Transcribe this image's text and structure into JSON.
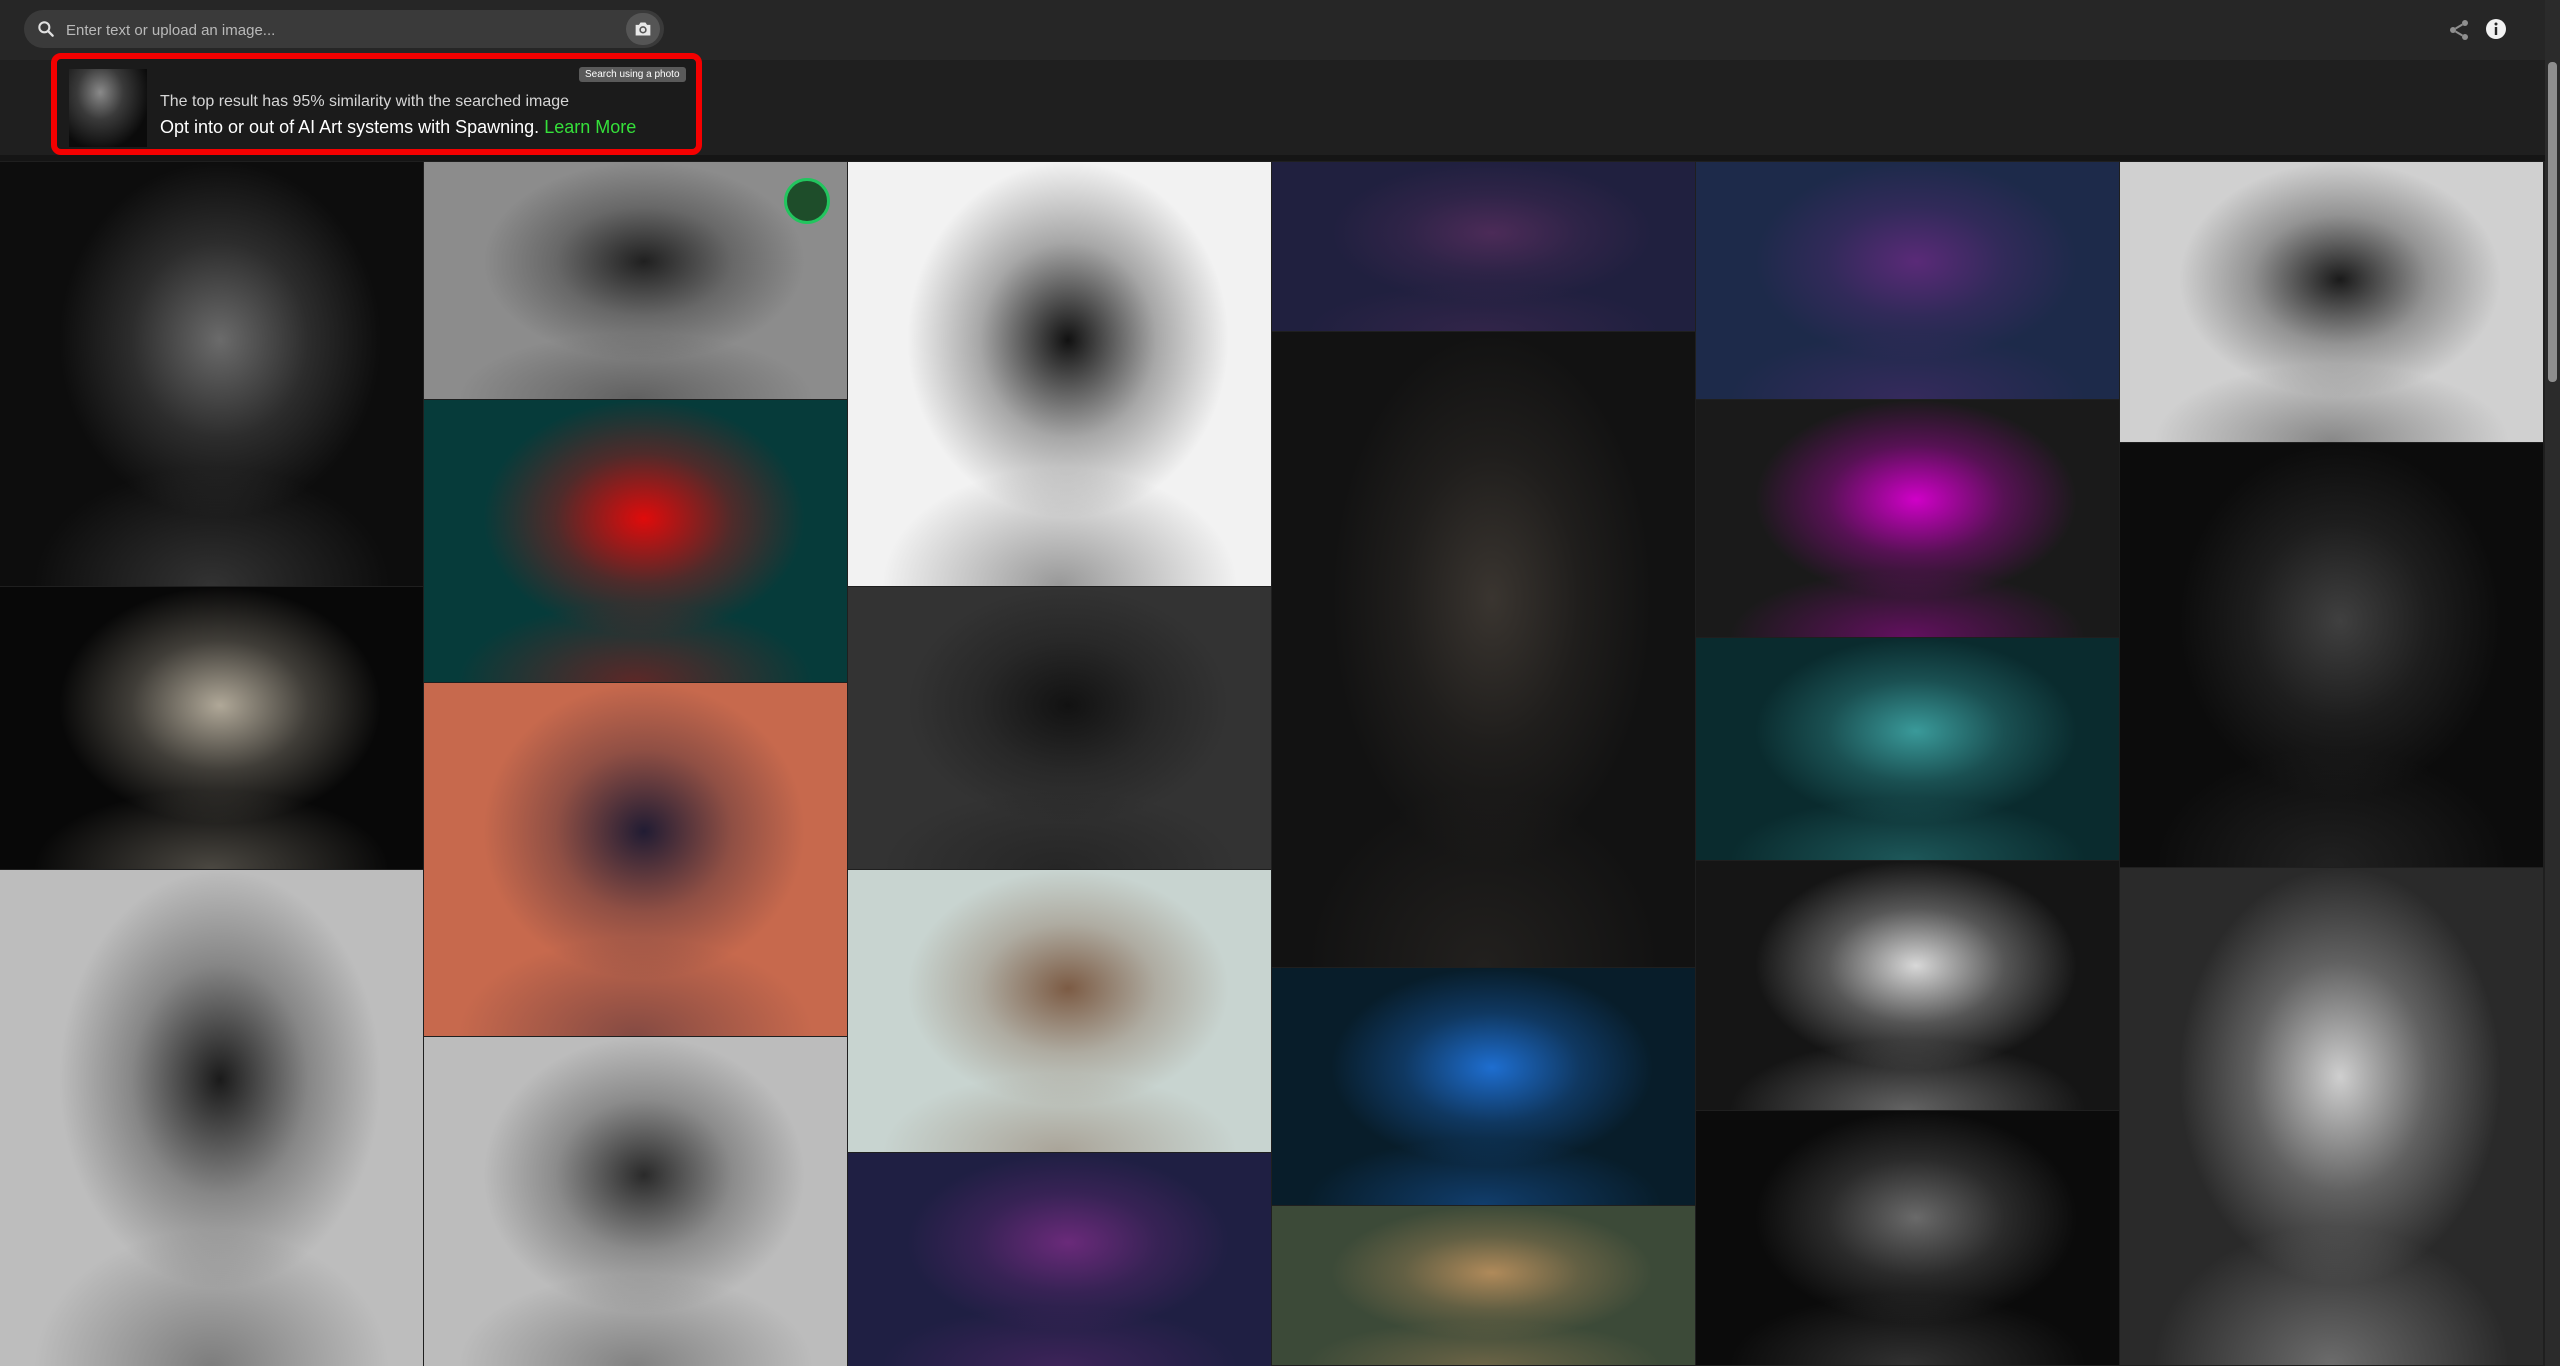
{
  "search": {
    "placeholder": "Enter text or upload an image..."
  },
  "toolbar": {
    "camera_tooltip": "Search using a photo",
    "icons": [
      "search-icon",
      "camera-icon",
      "share-icon",
      "info-icon"
    ]
  },
  "banner": {
    "similarity_text": "The top result has 95% similarity with the searched image",
    "optin_text": "Opt into or out of AI Art systems with Spawning.",
    "learn_more": "Learn More",
    "accent_color": "#35e03a",
    "border_color": "#f40000"
  },
  "results": {
    "columns": [
      [
        {
          "bg": "#0d0d0d",
          "accent": "#6b6b6b"
        },
        {
          "bg": "#080808",
          "accent": "#b0a898"
        },
        {
          "bg": "#bdbdbd",
          "accent": "#1a1a1a"
        }
      ],
      [
        {
          "bg": "#8c8c8c",
          "accent": "#202020"
        },
        {
          "bg": "#063b3a",
          "accent": "#e00b0b"
        },
        {
          "bg": "#c7694d",
          "accent": "#211c33"
        },
        {
          "bg": "#bcbcbc",
          "accent": "#2a2a2a"
        }
      ],
      [
        {
          "bg": "#f2f2f2",
          "accent": "#111111"
        },
        {
          "bg": "#333333",
          "accent": "#121212"
        },
        {
          "bg": "#c8d4d0",
          "accent": "#7c5b44"
        },
        {
          "bg": "#1f1f43",
          "accent": "#6a2a7a"
        }
      ],
      [
        {
          "bg": "#20203f",
          "accent": "#4c2b58"
        },
        {
          "bg": "#121212",
          "accent": "#3a3530"
        },
        {
          "bg": "#081d2a",
          "accent": "#1e6ed0"
        },
        {
          "bg": "#3c4a38",
          "accent": "#b08a5a"
        }
      ],
      [
        {
          "bg": "#1d2a4a",
          "accent": "#5a2a78"
        },
        {
          "bg": "#1a1a1a",
          "accent": "#d000c8"
        },
        {
          "bg": "#0a2b2e",
          "accent": "#3a9a9a"
        },
        {
          "bg": "#151515",
          "accent": "#d8d8d8"
        },
        {
          "bg": "#0b0b0b",
          "accent": "#6a6a6a"
        }
      ],
      [
        {
          "bg": "#d0d0d0",
          "accent": "#1a1a1a"
        },
        {
          "bg": "#0c0c0c",
          "accent": "#404040"
        },
        {
          "bg": "#2a2a2a",
          "accent": "#cfcfcf"
        }
      ]
    ]
  }
}
